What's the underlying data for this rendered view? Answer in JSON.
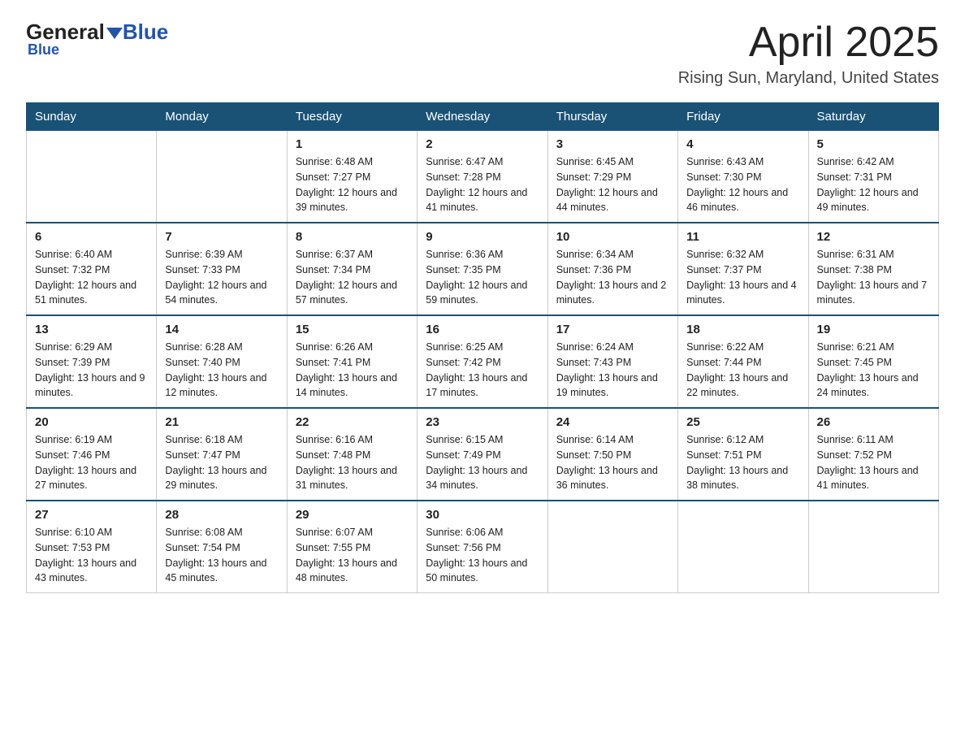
{
  "header": {
    "logo_general": "General",
    "logo_blue": "Blue",
    "month_title": "April 2025",
    "location": "Rising Sun, Maryland, United States"
  },
  "weekdays": [
    "Sunday",
    "Monday",
    "Tuesday",
    "Wednesday",
    "Thursday",
    "Friday",
    "Saturday"
  ],
  "weeks": [
    [
      {
        "day": "",
        "sunrise": "",
        "sunset": "",
        "daylight": ""
      },
      {
        "day": "",
        "sunrise": "",
        "sunset": "",
        "daylight": ""
      },
      {
        "day": "1",
        "sunrise": "Sunrise: 6:48 AM",
        "sunset": "Sunset: 7:27 PM",
        "daylight": "Daylight: 12 hours and 39 minutes."
      },
      {
        "day": "2",
        "sunrise": "Sunrise: 6:47 AM",
        "sunset": "Sunset: 7:28 PM",
        "daylight": "Daylight: 12 hours and 41 minutes."
      },
      {
        "day": "3",
        "sunrise": "Sunrise: 6:45 AM",
        "sunset": "Sunset: 7:29 PM",
        "daylight": "Daylight: 12 hours and 44 minutes."
      },
      {
        "day": "4",
        "sunrise": "Sunrise: 6:43 AM",
        "sunset": "Sunset: 7:30 PM",
        "daylight": "Daylight: 12 hours and 46 minutes."
      },
      {
        "day": "5",
        "sunrise": "Sunrise: 6:42 AM",
        "sunset": "Sunset: 7:31 PM",
        "daylight": "Daylight: 12 hours and 49 minutes."
      }
    ],
    [
      {
        "day": "6",
        "sunrise": "Sunrise: 6:40 AM",
        "sunset": "Sunset: 7:32 PM",
        "daylight": "Daylight: 12 hours and 51 minutes."
      },
      {
        "day": "7",
        "sunrise": "Sunrise: 6:39 AM",
        "sunset": "Sunset: 7:33 PM",
        "daylight": "Daylight: 12 hours and 54 minutes."
      },
      {
        "day": "8",
        "sunrise": "Sunrise: 6:37 AM",
        "sunset": "Sunset: 7:34 PM",
        "daylight": "Daylight: 12 hours and 57 minutes."
      },
      {
        "day": "9",
        "sunrise": "Sunrise: 6:36 AM",
        "sunset": "Sunset: 7:35 PM",
        "daylight": "Daylight: 12 hours and 59 minutes."
      },
      {
        "day": "10",
        "sunrise": "Sunrise: 6:34 AM",
        "sunset": "Sunset: 7:36 PM",
        "daylight": "Daylight: 13 hours and 2 minutes."
      },
      {
        "day": "11",
        "sunrise": "Sunrise: 6:32 AM",
        "sunset": "Sunset: 7:37 PM",
        "daylight": "Daylight: 13 hours and 4 minutes."
      },
      {
        "day": "12",
        "sunrise": "Sunrise: 6:31 AM",
        "sunset": "Sunset: 7:38 PM",
        "daylight": "Daylight: 13 hours and 7 minutes."
      }
    ],
    [
      {
        "day": "13",
        "sunrise": "Sunrise: 6:29 AM",
        "sunset": "Sunset: 7:39 PM",
        "daylight": "Daylight: 13 hours and 9 minutes."
      },
      {
        "day": "14",
        "sunrise": "Sunrise: 6:28 AM",
        "sunset": "Sunset: 7:40 PM",
        "daylight": "Daylight: 13 hours and 12 minutes."
      },
      {
        "day": "15",
        "sunrise": "Sunrise: 6:26 AM",
        "sunset": "Sunset: 7:41 PM",
        "daylight": "Daylight: 13 hours and 14 minutes."
      },
      {
        "day": "16",
        "sunrise": "Sunrise: 6:25 AM",
        "sunset": "Sunset: 7:42 PM",
        "daylight": "Daylight: 13 hours and 17 minutes."
      },
      {
        "day": "17",
        "sunrise": "Sunrise: 6:24 AM",
        "sunset": "Sunset: 7:43 PM",
        "daylight": "Daylight: 13 hours and 19 minutes."
      },
      {
        "day": "18",
        "sunrise": "Sunrise: 6:22 AM",
        "sunset": "Sunset: 7:44 PM",
        "daylight": "Daylight: 13 hours and 22 minutes."
      },
      {
        "day": "19",
        "sunrise": "Sunrise: 6:21 AM",
        "sunset": "Sunset: 7:45 PM",
        "daylight": "Daylight: 13 hours and 24 minutes."
      }
    ],
    [
      {
        "day": "20",
        "sunrise": "Sunrise: 6:19 AM",
        "sunset": "Sunset: 7:46 PM",
        "daylight": "Daylight: 13 hours and 27 minutes."
      },
      {
        "day": "21",
        "sunrise": "Sunrise: 6:18 AM",
        "sunset": "Sunset: 7:47 PM",
        "daylight": "Daylight: 13 hours and 29 minutes."
      },
      {
        "day": "22",
        "sunrise": "Sunrise: 6:16 AM",
        "sunset": "Sunset: 7:48 PM",
        "daylight": "Daylight: 13 hours and 31 minutes."
      },
      {
        "day": "23",
        "sunrise": "Sunrise: 6:15 AM",
        "sunset": "Sunset: 7:49 PM",
        "daylight": "Daylight: 13 hours and 34 minutes."
      },
      {
        "day": "24",
        "sunrise": "Sunrise: 6:14 AM",
        "sunset": "Sunset: 7:50 PM",
        "daylight": "Daylight: 13 hours and 36 minutes."
      },
      {
        "day": "25",
        "sunrise": "Sunrise: 6:12 AM",
        "sunset": "Sunset: 7:51 PM",
        "daylight": "Daylight: 13 hours and 38 minutes."
      },
      {
        "day": "26",
        "sunrise": "Sunrise: 6:11 AM",
        "sunset": "Sunset: 7:52 PM",
        "daylight": "Daylight: 13 hours and 41 minutes."
      }
    ],
    [
      {
        "day": "27",
        "sunrise": "Sunrise: 6:10 AM",
        "sunset": "Sunset: 7:53 PM",
        "daylight": "Daylight: 13 hours and 43 minutes."
      },
      {
        "day": "28",
        "sunrise": "Sunrise: 6:08 AM",
        "sunset": "Sunset: 7:54 PM",
        "daylight": "Daylight: 13 hours and 45 minutes."
      },
      {
        "day": "29",
        "sunrise": "Sunrise: 6:07 AM",
        "sunset": "Sunset: 7:55 PM",
        "daylight": "Daylight: 13 hours and 48 minutes."
      },
      {
        "day": "30",
        "sunrise": "Sunrise: 6:06 AM",
        "sunset": "Sunset: 7:56 PM",
        "daylight": "Daylight: 13 hours and 50 minutes."
      },
      {
        "day": "",
        "sunrise": "",
        "sunset": "",
        "daylight": ""
      },
      {
        "day": "",
        "sunrise": "",
        "sunset": "",
        "daylight": ""
      },
      {
        "day": "",
        "sunrise": "",
        "sunset": "",
        "daylight": ""
      }
    ]
  ]
}
